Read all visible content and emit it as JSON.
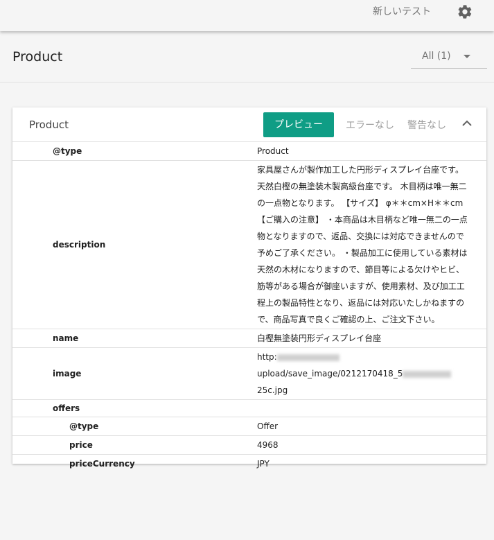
{
  "topbar": {
    "new_test_label": "新しいテスト",
    "settings_icon": "gear-icon"
  },
  "header": {
    "title": "Product",
    "filter_value": "All (1)"
  },
  "card": {
    "title": "Product",
    "preview_label": "プレビュー",
    "errors_label": "エラーなし",
    "warnings_label": "警告なし",
    "accent_color": "#0f9d85"
  },
  "properties": {
    "type": {
      "key": "@type",
      "value": "Product"
    },
    "description": {
      "key": "description",
      "value": "家具屋さんが製作加工した円形ディスプレイ台座です。 天然白樫の無塗装木製高級台座です。 木目柄は唯一無二の一点物となります。 【サイズ】 φ＊＊cm×H＊＊cm 【ご購入の注意】 ・本商品は木目柄など唯一無二の一点物となりますので、返品、交換には対応できませんので予めご了承ください。 ・製品加工に使用している素材は天然の木材になりますので、節目等による欠けやヒビ、筋等がある場合が御座いますが、使用素材、及び加工工程上の製品特性となり、返品には対応いたしかねますので、商品写真で良くご確認の上、ご注文下さい。"
    },
    "name": {
      "key": "name",
      "value": "白樫無塗装円形ディスプレイ台座"
    },
    "image": {
      "key": "image",
      "value_prefix": "http:",
      "value_mid": "upload/save_image/0212170418_5",
      "value_suffix": "25c.jpg"
    },
    "offers": {
      "key": "offers",
      "type": {
        "key": "@type",
        "value": "Offer"
      },
      "price": {
        "key": "price",
        "value": "4968"
      },
      "priceCurrency": {
        "key": "priceCurrency",
        "value": "JPY"
      }
    }
  }
}
